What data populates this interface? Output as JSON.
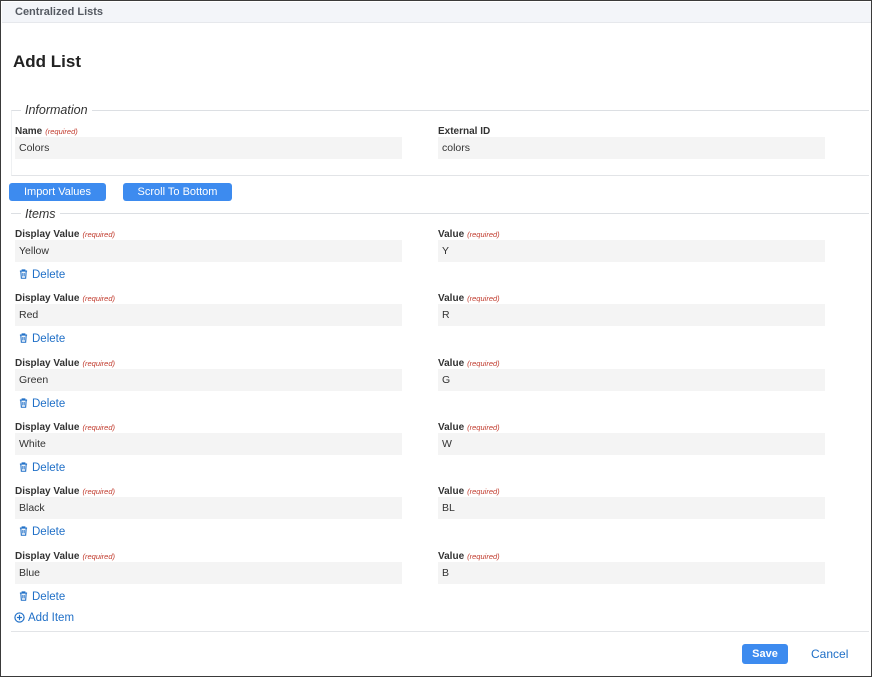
{
  "app": {
    "breadcrumb": "Centralized Lists"
  },
  "page": {
    "title": "Add List"
  },
  "information": {
    "legend": "Information",
    "name_label": "Name",
    "name_required": "(required)",
    "name_value": "Colors",
    "external_id_label": "External ID",
    "external_id_value": "colors"
  },
  "toolbar": {
    "import_label": "Import Values",
    "scroll_label": "Scroll To Bottom"
  },
  "items": {
    "legend": "Items",
    "display_label": "Display Value",
    "value_label": "Value",
    "required_text": "(required)",
    "delete_label": "Delete",
    "add_item_label": "Add Item",
    "rows": [
      {
        "display": "Yellow",
        "value": "Y"
      },
      {
        "display": "Red",
        "value": "R"
      },
      {
        "display": "Green",
        "value": "G"
      },
      {
        "display": "White",
        "value": "W"
      },
      {
        "display": "Black",
        "value": "BL"
      },
      {
        "display": "Blue",
        "value": "B"
      }
    ]
  },
  "footer": {
    "save_label": "Save",
    "cancel_label": "Cancel"
  },
  "icons": {
    "delete": "trash-icon",
    "add": "plus-circle-icon"
  },
  "colors": {
    "primary": "#3d8bef",
    "link": "#1f6fc7",
    "required": "#c0392b"
  }
}
